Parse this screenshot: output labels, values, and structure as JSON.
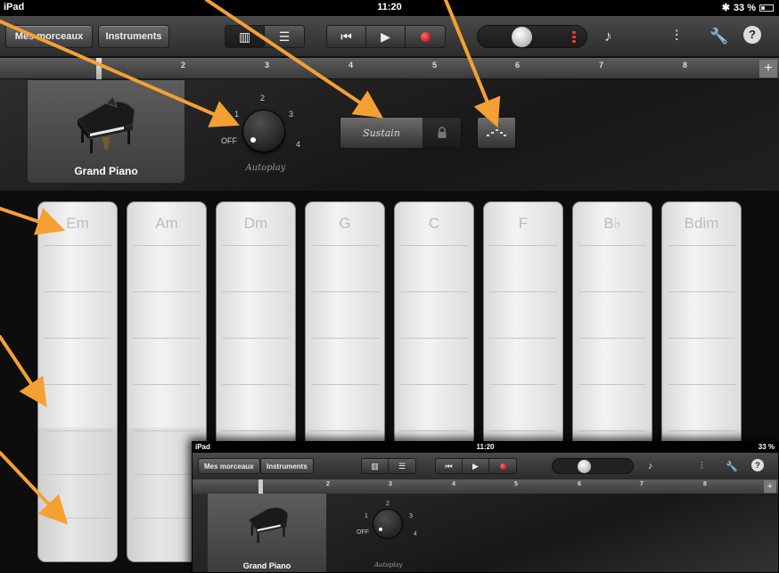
{
  "status_bar": {
    "device": "iPad",
    "time": "11:20",
    "battery": "33 %"
  },
  "toolbar": {
    "my_songs_label": "Mes morceaux",
    "instruments_label": "Instruments"
  },
  "ruler": {
    "bars": [
      "2",
      "3",
      "4",
      "5",
      "6",
      "7",
      "8"
    ],
    "add_label": "+"
  },
  "instrument": {
    "name": "Grand Piano",
    "autoplay": {
      "label": "Autoplay",
      "positions": [
        "OFF",
        "1",
        "2",
        "3",
        "4"
      ],
      "selected": "OFF"
    },
    "sustain_label": "Sustain"
  },
  "chord_strips": [
    "Em",
    "Am",
    "Dm",
    "G",
    "C",
    "F",
    "B♭",
    "Bdim"
  ],
  "inset": {
    "status_bar": {
      "device": "iPad",
      "time": "11:20",
      "battery": "33 %"
    },
    "my_songs_label": "Mes morceaux",
    "instruments_label": "Instruments",
    "ruler_bars": [
      "2",
      "3",
      "4",
      "5",
      "6",
      "7",
      "8"
    ],
    "instrument_name": "Grand Piano",
    "autoplay": {
      "label": "Autoplay",
      "positions": [
        "OFF",
        "1",
        "2",
        "3",
        "4"
      ]
    }
  },
  "colors": {
    "annotation_arrow": "#f5a033",
    "record": "#e02020"
  }
}
